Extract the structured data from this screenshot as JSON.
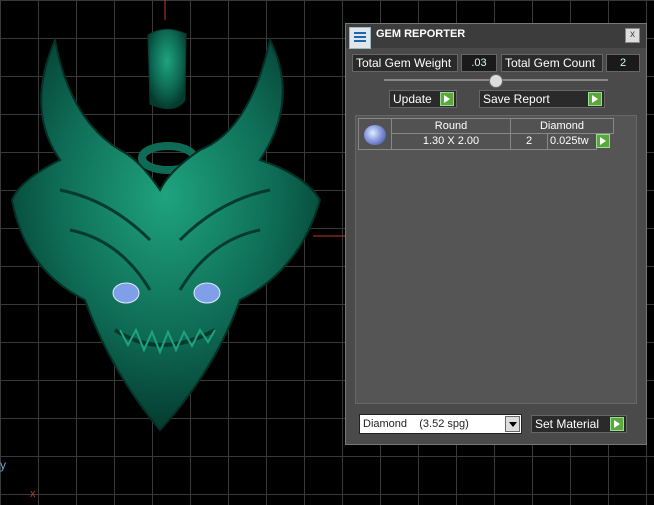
{
  "panel": {
    "title": "GEM REPORTER",
    "close": "x",
    "total_weight_label": "Total Gem Weight",
    "total_weight_value": ".03",
    "total_count_label": "Total Gem Count",
    "total_count_value": "2",
    "update_label": "Update",
    "save_report_label": "Save Report",
    "table": {
      "headers": [
        "Round",
        "Diamond"
      ],
      "rows": [
        {
          "icon": "gem-icon",
          "size": "1.30 X 2.00",
          "count": "2",
          "weight": "0.025tw"
        }
      ]
    },
    "material_select": "Diamond    (3.52 spg)",
    "set_material_label": "Set Material"
  },
  "viewport": {
    "axis_label": "y",
    "colors": {
      "model": "#0e6b55",
      "axis_red": "#c0392b",
      "panel_bg": "#4a4a4a"
    }
  }
}
